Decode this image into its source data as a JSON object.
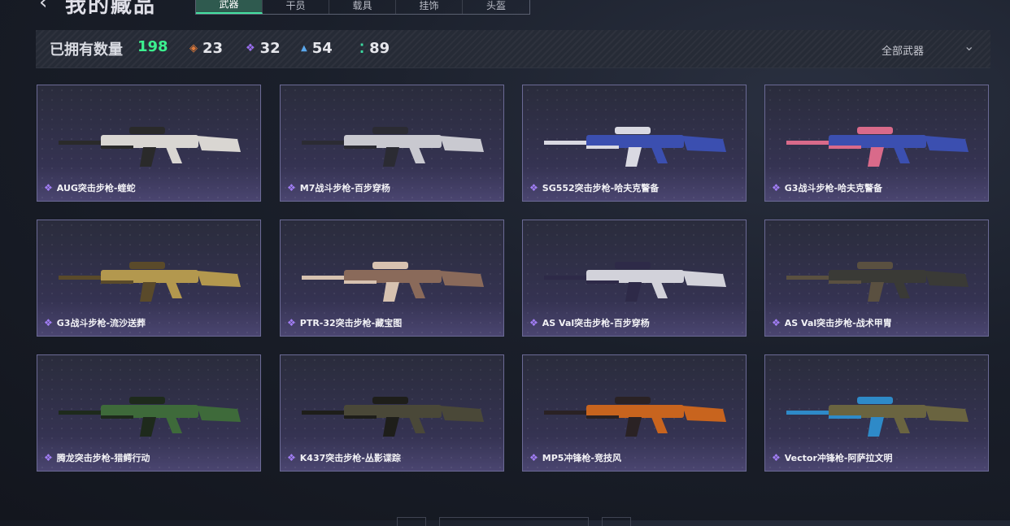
{
  "header": {
    "back_icon": "chevron-left-icon",
    "title": "我的藏品",
    "tabs": [
      {
        "label": "武器",
        "active": true
      },
      {
        "label": "干员",
        "active": false
      },
      {
        "label": "载具",
        "active": false
      },
      {
        "label": "挂饰",
        "active": false
      },
      {
        "label": "头盔",
        "active": false
      }
    ]
  },
  "stats": {
    "owned_label": "已拥有数量",
    "owned_count": "198",
    "rarities": [
      {
        "icon": "orange-diamond-icon",
        "color": "#e07a3a",
        "glyph": "◈",
        "count": "23"
      },
      {
        "icon": "purple-diamond-icon",
        "color": "#9b6ff0",
        "glyph": "❖",
        "count": "32"
      },
      {
        "icon": "blue-triangle-icon",
        "color": "#5aa8ee",
        "glyph": "▲",
        "count": "54"
      },
      {
        "icon": "green-dots-icon",
        "color": "#3cd9a0",
        "glyph": "⁚",
        "count": "89"
      }
    ],
    "filter_label": "全部武器",
    "filter_icon": "chevron-down-icon"
  },
  "weapons": [
    {
      "name": "AUG突击步枪-蝰蛇",
      "rarity_icon": "purple-diamond-icon",
      "body": "#d9d6d2",
      "accent": "#2a2a2a"
    },
    {
      "name": "M7战斗步枪-百步穿杨",
      "rarity_icon": "purple-diamond-icon",
      "body": "#c9c9d0",
      "accent": "#2b2b33"
    },
    {
      "name": "SG552突击步枪-哈夫克警备",
      "rarity_icon": "purple-diamond-icon",
      "body": "#3b4fb0",
      "accent": "#d9d9e2"
    },
    {
      "name": "G3战斗步枪-哈夫克警备",
      "rarity_icon": "purple-diamond-icon",
      "body": "#3b4fb0",
      "accent": "#d96a8a"
    },
    {
      "name": "G3战斗步枪-流沙送葬",
      "rarity_icon": "purple-diamond-icon",
      "body": "#b3984e",
      "accent": "#5a4a2a"
    },
    {
      "name": "PTR-32突击步枪-藏宝图",
      "rarity_icon": "purple-diamond-icon",
      "body": "#8a6a5a",
      "accent": "#d7c2b0"
    },
    {
      "name": "AS Val突击步枪-百步穿杨",
      "rarity_icon": "purple-diamond-icon",
      "body": "#d2d2da",
      "accent": "#2e2a48"
    },
    {
      "name": "AS Val突击步枪-战术甲胄",
      "rarity_icon": "purple-diamond-icon",
      "body": "#3a3a36",
      "accent": "#5a5040"
    },
    {
      "name": "腾龙突击步枪-猎鳄行动",
      "rarity_icon": "purple-diamond-icon",
      "body": "#3e6a3a",
      "accent": "#1e2a1c"
    },
    {
      "name": "K437突击步枪-丛影谍踪",
      "rarity_icon": "purple-diamond-icon",
      "body": "#4a4838",
      "accent": "#1e1e1a"
    },
    {
      "name": "MP5冲锋枪-竞技风",
      "rarity_icon": "purple-diamond-icon",
      "body": "#c8641e",
      "accent": "#2a2224"
    },
    {
      "name": "Vector冲锋枪-阿萨拉文明",
      "rarity_icon": "purple-diamond-icon",
      "body": "#6a6440",
      "accent": "#2e8ac8"
    }
  ]
}
